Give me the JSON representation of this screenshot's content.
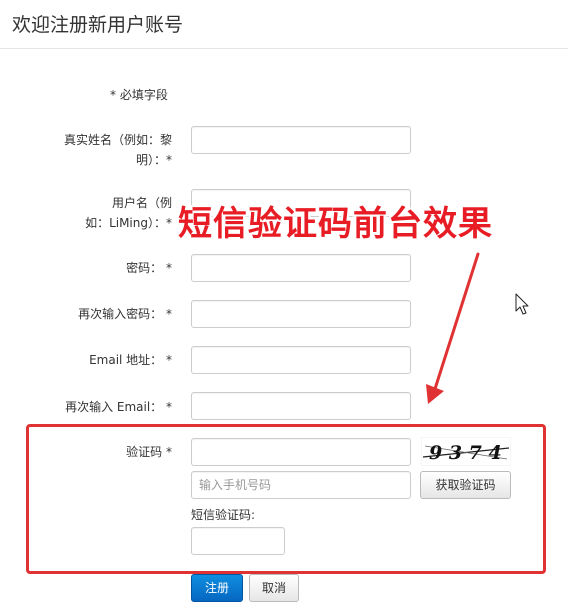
{
  "page": {
    "title": "欢迎注册新用户账号",
    "required_note": "* 必填字段"
  },
  "form": {
    "realname": {
      "label_line1": "真实姓名（例如：黎",
      "label_line2": "明）：*"
    },
    "username": {
      "label_line1": "用户名（例",
      "label_line2": "如：LiMing）：*"
    },
    "password": {
      "label": "密码： *"
    },
    "password_confirm": {
      "label": "再次输入密码： *"
    },
    "email": {
      "label": "Email 地址： *"
    },
    "email_confirm": {
      "label": "再次输入 Email： *"
    }
  },
  "verification": {
    "captcha_label": "验证码 *",
    "captcha_text": "9 3 7 4",
    "phone_placeholder": "输入手机号码",
    "get_code_button": "获取验证码",
    "sms_label": "短信验证码:"
  },
  "actions": {
    "register_button": "注册",
    "cancel_button": "取消"
  },
  "annotation": {
    "text": "短信验证码前台效果",
    "color": "#e81c24"
  },
  "colors": {
    "primary": "#0a7ad6",
    "highlight": "#e03232"
  }
}
